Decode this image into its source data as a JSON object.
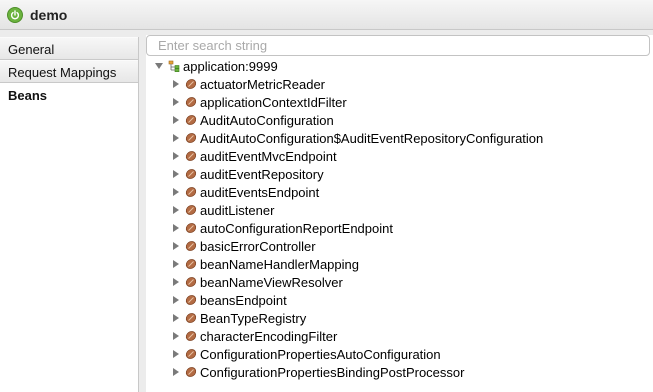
{
  "window": {
    "title": "demo",
    "icon": "spring-power-icon",
    "accent": "#6bb33e"
  },
  "sidebar": {
    "items": [
      {
        "label": "General",
        "active": false
      },
      {
        "label": "Request Mappings",
        "active": false
      },
      {
        "label": "Beans",
        "active": true
      }
    ]
  },
  "search": {
    "placeholder": "Enter search string",
    "value": ""
  },
  "tree": {
    "root": {
      "label": "application:9999",
      "expanded": true,
      "icon": "context-hierarchy-icon"
    },
    "children": [
      "actuatorMetricReader",
      "applicationContextIdFilter",
      "AuditAutoConfiguration",
      "AuditAutoConfiguration$AuditEventRepositoryConfiguration",
      "auditEventMvcEndpoint",
      "auditEventRepository",
      "auditEventsEndpoint",
      "auditListener",
      "autoConfigurationReportEndpoint",
      "basicErrorController",
      "beanNameHandlerMapping",
      "beanNameViewResolver",
      "beansEndpoint",
      "BeanTypeRegistry",
      "characterEncodingFilter",
      "ConfigurationPropertiesAutoConfiguration",
      "ConfigurationPropertiesBindingPostProcessor"
    ],
    "child_icon": "bean-icon"
  }
}
